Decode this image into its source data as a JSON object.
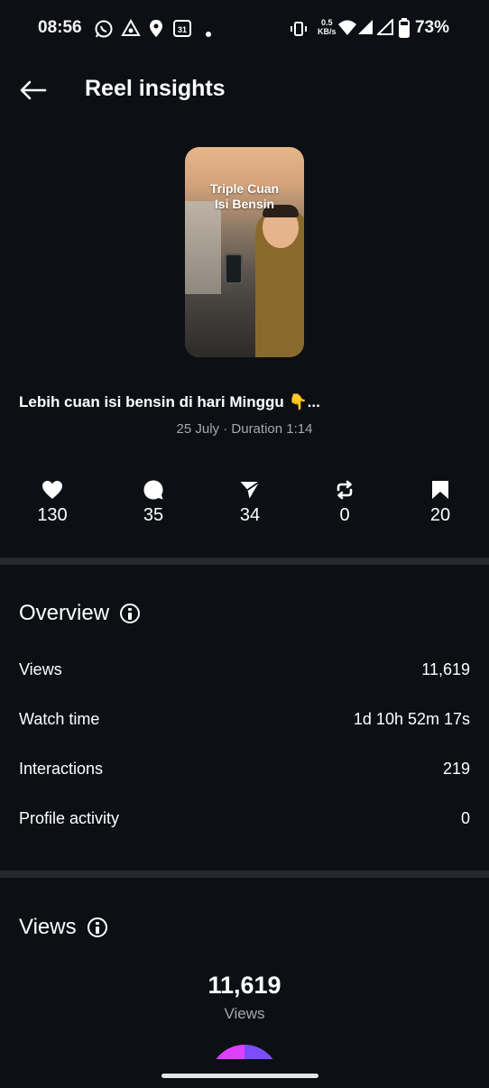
{
  "status_bar": {
    "time": "08:56",
    "net_speed_value": "0.5",
    "net_speed_unit": "KB/s",
    "battery": "73%",
    "calendar_day": "31"
  },
  "header": {
    "title": "Reel insights"
  },
  "reel": {
    "thumbnail_text_line1": "Triple Cuan",
    "thumbnail_text_line2": "Isi Bensin",
    "caption": "Lebih cuan isi bensin di hari Minggu 👇...",
    "meta": "25 July · Duration 1:14"
  },
  "stats": [
    {
      "icon": "heart-icon",
      "value": "130"
    },
    {
      "icon": "comment-icon",
      "value": "35"
    },
    {
      "icon": "share-icon",
      "value": "34"
    },
    {
      "icon": "repost-icon",
      "value": "0"
    },
    {
      "icon": "bookmark-icon",
      "value": "20"
    }
  ],
  "overview": {
    "title": "Overview",
    "rows": [
      {
        "label": "Views",
        "value": "11,619"
      },
      {
        "label": "Watch time",
        "value": "1d 10h 52m 17s"
      },
      {
        "label": "Interactions",
        "value": "219"
      },
      {
        "label": "Profile activity",
        "value": "0"
      }
    ]
  },
  "views_section": {
    "title": "Views",
    "total": "11,619",
    "label": "Views",
    "colors": {
      "segment_a": "#e040fb",
      "segment_b": "#7c4dff"
    }
  }
}
